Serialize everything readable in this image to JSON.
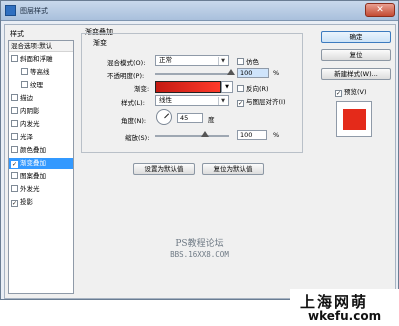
{
  "window": {
    "title": "图层样式"
  },
  "sidebar": {
    "header": "样式",
    "items": [
      {
        "label": "混合选项:默认",
        "type": "head"
      },
      {
        "label": "斜面和浮雕",
        "checked": false
      },
      {
        "label": "等高线",
        "checked": false,
        "indent": true
      },
      {
        "label": "纹理",
        "checked": false,
        "indent": true
      },
      {
        "label": "描边",
        "checked": false
      },
      {
        "label": "内阴影",
        "checked": false
      },
      {
        "label": "内发光",
        "checked": false
      },
      {
        "label": "光泽",
        "checked": false
      },
      {
        "label": "颜色叠加",
        "checked": false
      },
      {
        "label": "渐变叠加",
        "checked": true,
        "selected": true
      },
      {
        "label": "图案叠加",
        "checked": false
      },
      {
        "label": "外发光",
        "checked": false
      },
      {
        "label": "投影",
        "checked": true
      }
    ]
  },
  "panel": {
    "title": "渐变叠加",
    "group_title": "渐变",
    "blend_mode_label": "混合模式(O):",
    "blend_mode_value": "正常",
    "dither_label": "仿色",
    "opacity_label": "不透明度(P):",
    "opacity_value": "100",
    "opacity_unit": "%",
    "opacity_level": 1.0,
    "gradient_label": "渐变:",
    "reverse_label": "反向(R)",
    "style_label": "样式(L):",
    "style_value": "线性",
    "align_label": "与图层对齐(I)",
    "angle_label": "角度(N):",
    "angle_value": "45",
    "angle_unit": "度",
    "scale_label": "缩放(S):",
    "scale_value": "100",
    "scale_unit": "%",
    "scale_level": 0.67,
    "reset_default_button": "设置为默认值",
    "restore_default_button": "复位为默认值"
  },
  "actions": {
    "ok": "确定",
    "reset": "复位",
    "new_style": "新建样式(W)...",
    "preview_label": "预览(V)",
    "preview_checked": true
  },
  "colors": {
    "gradient_start": "#c41a12",
    "gradient_end": "#ff3a2a",
    "preview": "#e42a1a",
    "selection": "#3399ff"
  },
  "watermark": {
    "line1": "PS教程论坛",
    "line2": "BBS.16XX8.COM"
  },
  "brand": {
    "name": "上海网萌",
    "url": "wkefu.com"
  }
}
